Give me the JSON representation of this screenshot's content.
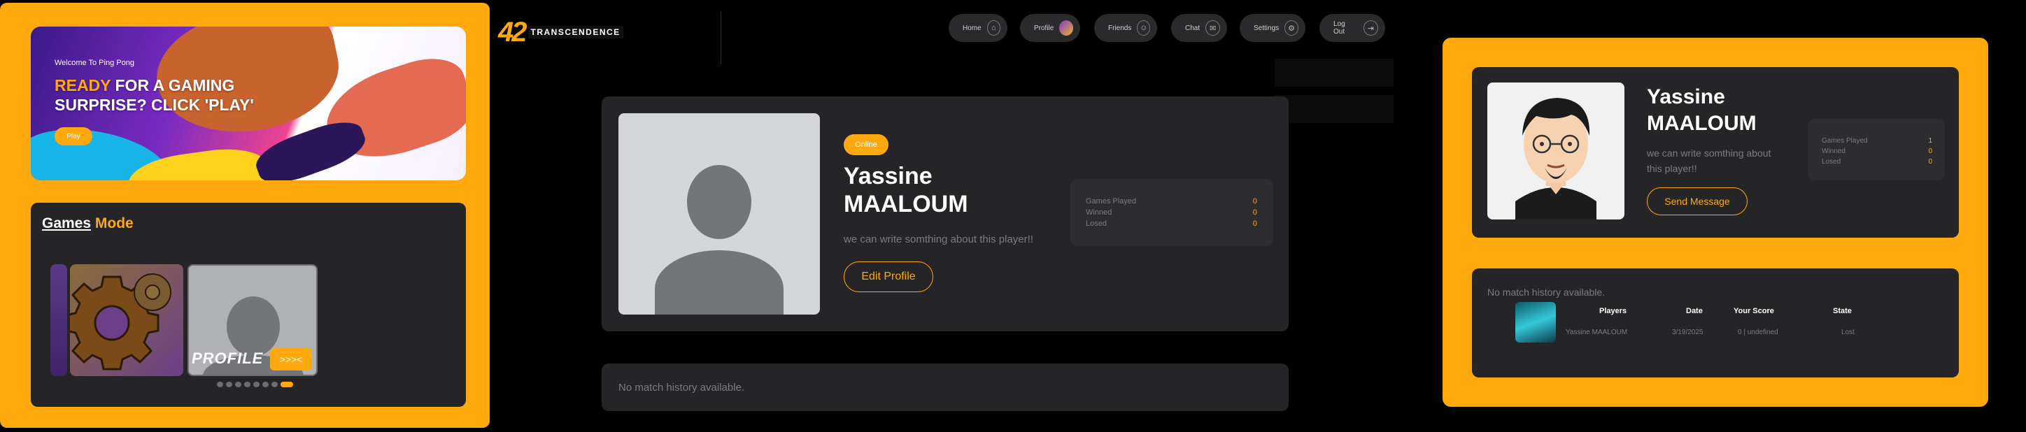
{
  "colors": {
    "accent": "#FFA90F",
    "card": "#252527",
    "background": "#000000",
    "muted": "#7c7c80"
  },
  "hero": {
    "welcome": "Welcome To Ping Pong",
    "headline_highlight": "READY",
    "headline_rest": " FOR A GAMING SURPRISE? CLICK 'PLAY'",
    "play_label": "Play"
  },
  "games": {
    "title_white": "Games",
    "title_orange": "Mode",
    "tiles": [
      {
        "icon": "gear-icon"
      },
      {
        "label": "PROFILE",
        "button": ">>><",
        "icon": "user-placeholder-icon"
      }
    ],
    "dots_count": 8,
    "active_dot": 7
  },
  "logo": {
    "number": "42",
    "text": "TRANSCENDENCE"
  },
  "nav": {
    "items": [
      {
        "label": "Home",
        "icon": "home-icon"
      },
      {
        "label": "Profile",
        "icon": "avatar-icon"
      },
      {
        "label": "Friends",
        "icon": "friends-icon"
      },
      {
        "label": "Chat",
        "icon": "chat-icon"
      },
      {
        "label": "Settings",
        "icon": "gear-icon"
      },
      {
        "label": "Log Out",
        "icon": "logout-icon"
      }
    ]
  },
  "profile": {
    "status": "Online",
    "first_name": "Yassine",
    "last_name": "MAALOUM",
    "bio": "we can write somthing about this player!!",
    "edit_label": "Edit Profile",
    "stats": [
      {
        "label": "Games Played",
        "value": "0"
      },
      {
        "label": "Winned",
        "value": "0"
      },
      {
        "label": "Losed",
        "value": "0"
      }
    ],
    "history_empty": "No match history available."
  },
  "other_profile": {
    "first_name": "Yassine",
    "last_name": "MAALOUM",
    "bio": "we can write somthing about this player!!",
    "send_label": "Send Message",
    "stats": [
      {
        "label": "Games Played",
        "value": "1"
      },
      {
        "label": "Winned",
        "value": "0"
      },
      {
        "label": "Losed",
        "value": "0"
      }
    ],
    "history_empty": "No match history available.",
    "history_headers": [
      "Players",
      "Date",
      "Your Score",
      "State"
    ],
    "history_row": [
      "Yassine MAALOUM",
      "3/19/2025",
      "0 | undefined",
      "Lost"
    ]
  }
}
